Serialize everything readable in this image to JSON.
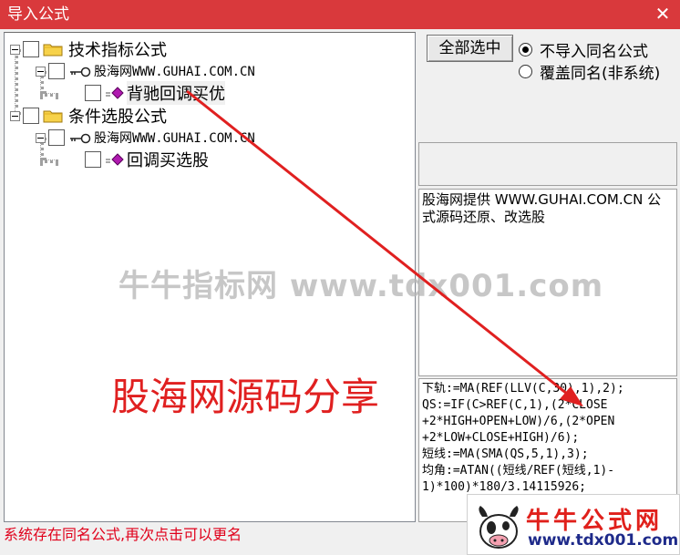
{
  "window": {
    "title": "导入公式",
    "close_glyph": "✕"
  },
  "tree": {
    "group1": {
      "label": "技术指标公式",
      "source": "股海网WWW.GUHAI.COM.CN",
      "item": "背驰回调买优"
    },
    "group2": {
      "label": "条件选股公式",
      "source": "股海网WWW.GUHAI.COM.CN",
      "item": "回调买选股"
    }
  },
  "controls": {
    "select_all": "全部选中",
    "radio_no_import": "不导入同名公式",
    "radio_overwrite": "覆盖同名(非系统)",
    "selected": "no_import"
  },
  "description": "股海网提供 WWW.GUHAI.COM.CN 公式源码还原、改选股",
  "code_lines": [
    "下轨:=MA(REF(LLV(C,30),1),2);",
    "QS:=IF(C>REF(C,1),(2*CLOSE",
    "+2*HIGH+OPEN+LOW)/6,(2*OPEN",
    "+2*LOW+CLOSE+HIGH)/6);",
    "短线:=MA(SMA(QS,5,1),3);",
    "均角:=ATAN((短线/REF(短线,1)-",
    "1)*100)*180/3.14115926;"
  ],
  "status_text": "系统存在同名公式,再次点击可以更名",
  "overlay": {
    "watermark": "牛牛指标网 www.tdx001.com",
    "share_text": "股海网源码分享",
    "logo_title": "牛牛公式网",
    "logo_url": "www.tdx001.com"
  },
  "colors": {
    "titlebar": "#d9393c",
    "status_text": "#e0001b",
    "arrow": "#e02020"
  },
  "icons": {
    "folder": "folder-icon",
    "key": "key-icon",
    "formula": "formula-icon",
    "expander": "minus-box-icon"
  }
}
